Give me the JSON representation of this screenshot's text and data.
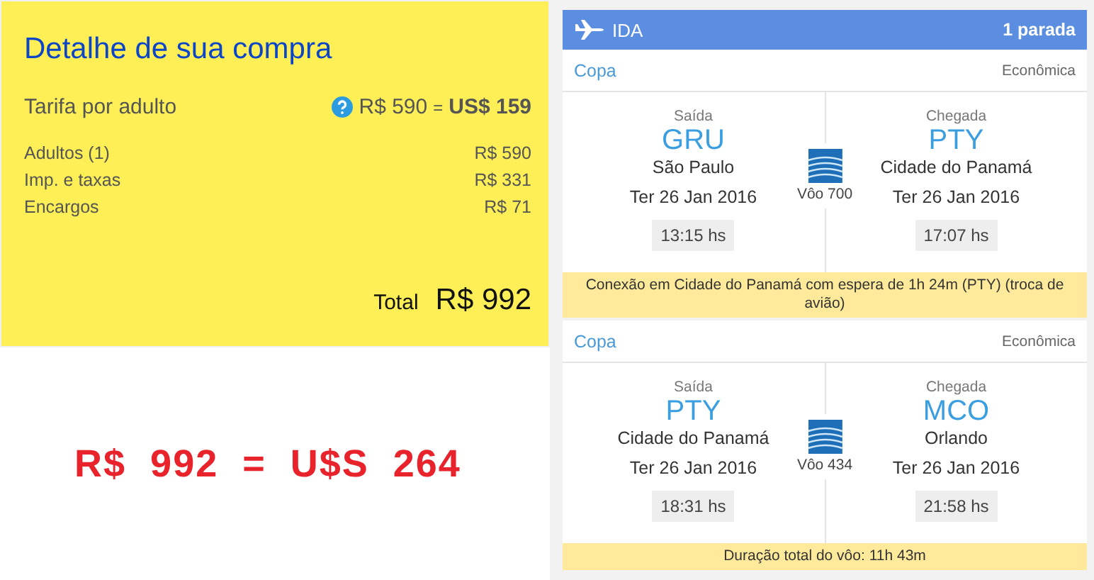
{
  "summary": {
    "title": "Detalhe de sua compra",
    "fare_label": "Tarifa por adulto",
    "fare_local": "R$ 590",
    "fare_equals": "=",
    "fare_usd": "US$ 159",
    "lines": [
      {
        "label": "Adultos (1)",
        "value": "R$ 590"
      },
      {
        "label": "Imp. e taxas",
        "value": "R$ 331"
      },
      {
        "label": "Encargos",
        "value": "R$ 71"
      }
    ],
    "total_label": "Total",
    "total_value": "R$ 992"
  },
  "conversion": "R$  992  =  U$S  264",
  "itinerary": {
    "direction": "IDA",
    "stops": "1 parada",
    "segments": [
      {
        "airline": "Copa",
        "cabin": "Econômica",
        "flight": "Vôo 700",
        "departure": {
          "label": "Saída",
          "code": "GRU",
          "city": "São Paulo",
          "date": "Ter 26 Jan 2016",
          "time": "13:15 hs"
        },
        "arrival": {
          "label": "Chegada",
          "code": "PTY",
          "city": "Cidade do Panamá",
          "date": "Ter 26 Jan 2016",
          "time": "17:07 hs"
        },
        "note": "Conexão em Cidade do Panamá com espera de 1h 24m (PTY) (troca de avião)"
      },
      {
        "airline": "Copa",
        "cabin": "Econômica",
        "flight": "Vôo 434",
        "departure": {
          "label": "Saída",
          "code": "PTY",
          "city": "Cidade do Panamá",
          "date": "Ter 26 Jan 2016",
          "time": "18:31 hs"
        },
        "arrival": {
          "label": "Chegada",
          "code": "MCO",
          "city": "Orlando",
          "date": "Ter 26 Jan 2016",
          "time": "21:58 hs"
        },
        "note": "Duração total do vôo: 11h 43m"
      }
    ]
  }
}
